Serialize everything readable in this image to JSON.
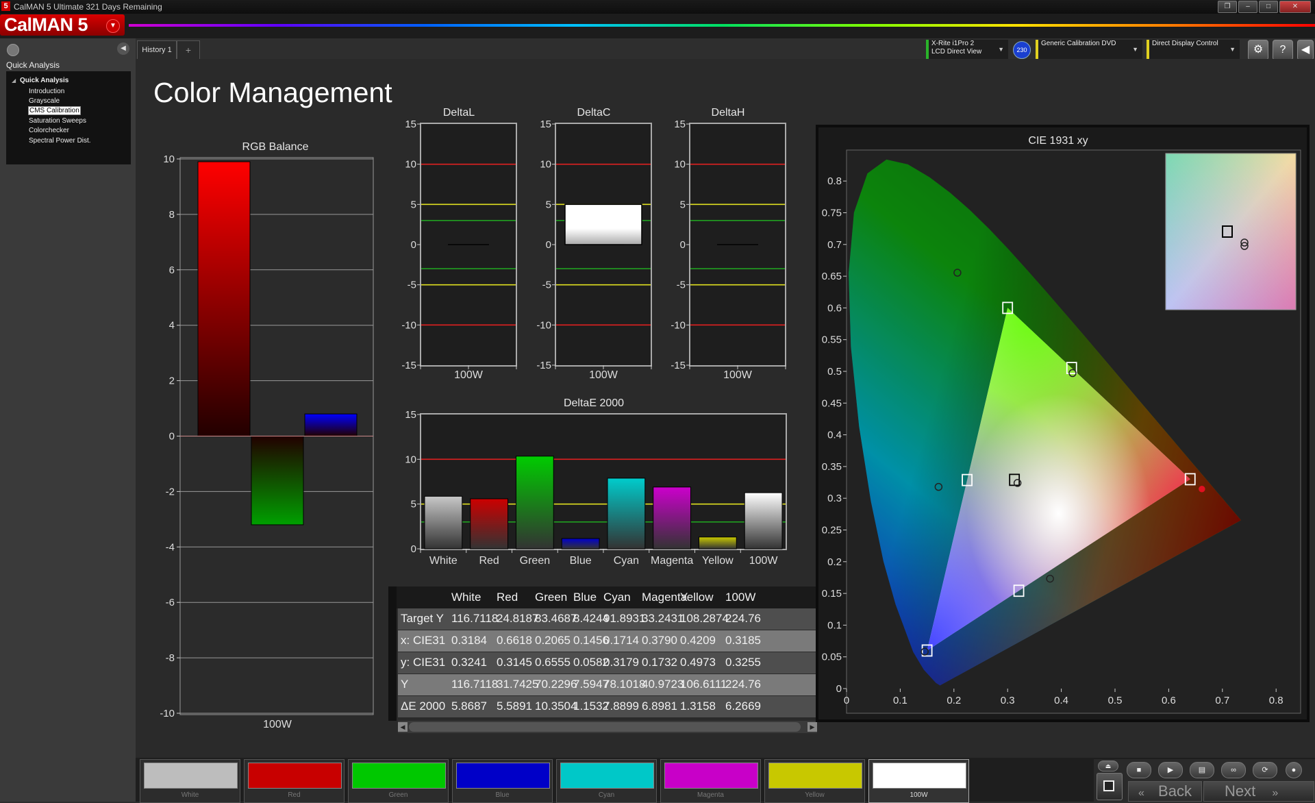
{
  "window": {
    "title": "CalMAN 5 Ultimate 321 Days Remaining",
    "logo_mark": "5",
    "controls": [
      "restore-icon",
      "minimize-icon",
      "maximize-icon",
      "close-icon"
    ]
  },
  "brand": {
    "name": "CalMAN 5"
  },
  "sidebar": {
    "heading": "Quick Analysis",
    "tree_root": "Quick Analysis",
    "items": [
      {
        "label": "Introduction",
        "selected": false
      },
      {
        "label": "Grayscale",
        "selected": false
      },
      {
        "label": "CMS Calibration",
        "selected": true
      },
      {
        "label": "Saturation Sweeps",
        "selected": false
      },
      {
        "label": "Colorchecker",
        "selected": false
      },
      {
        "label": "Spectral Power Dist.",
        "selected": false
      }
    ]
  },
  "tabs": {
    "history": "History 1",
    "add": "+"
  },
  "devices": {
    "meter_line1": "X-Rite i1Pro 2",
    "meter_line2": "LCD Direct View",
    "badge": "230",
    "source": "Generic Calibration DVD",
    "display": "Direct Display Control"
  },
  "page": {
    "title": "Color Management"
  },
  "rgb_balance": {
    "title": "RGB Balance",
    "category": "100W",
    "yticks": [
      "10",
      "8",
      "6",
      "4",
      "2",
      "0",
      "-2",
      "-4",
      "-6",
      "-8",
      "-10"
    ]
  },
  "delta_charts": {
    "deltal": {
      "title": "DeltaL",
      "category": "100W"
    },
    "deltac": {
      "title": "DeltaC",
      "category": "100W"
    },
    "deltah": {
      "title": "DeltaH",
      "category": "100W"
    },
    "yticks": [
      "15",
      "10",
      "5",
      "0",
      "-5",
      "-10",
      "-15"
    ]
  },
  "deltae": {
    "title": "DeltaE 2000",
    "yticks": [
      "15",
      "10",
      "5",
      "0"
    ]
  },
  "cie": {
    "title": "CIE 1931 xy",
    "xticks": [
      "0",
      "0.1",
      "0.2",
      "0.3",
      "0.4",
      "0.5",
      "0.6",
      "0.7",
      "0.8"
    ],
    "yticks": [
      "0",
      "0.05",
      "0.1",
      "0.15",
      "0.2",
      "0.25",
      "0.3",
      "0.35",
      "0.4",
      "0.45",
      "0.5",
      "0.55",
      "0.6",
      "0.65",
      "0.7",
      "0.75",
      "0.8"
    ]
  },
  "table": {
    "headers": [
      "",
      "White",
      "Red",
      "Green",
      "Blue",
      "Cyan",
      "Magenta",
      "Yellow",
      "100W"
    ],
    "rows": [
      [
        "Target Y",
        "116.7118",
        "24.8187",
        "83.4687",
        "8.4244",
        "91.8931",
        "33.2431",
        "108.2874",
        "224.76"
      ],
      [
        "x: CIE31",
        "0.3184",
        "0.6618",
        "0.2065",
        "0.1456",
        "0.1714",
        "0.3790",
        "0.4209",
        "0.3185"
      ],
      [
        "y: CIE31",
        "0.3241",
        "0.3145",
        "0.6555",
        "0.0582",
        "0.3179",
        "0.1732",
        "0.4973",
        "0.3255"
      ],
      [
        "Y",
        "116.7118",
        "31.7425",
        "70.2296",
        "7.5947",
        "78.1018",
        "40.9723",
        "106.6111",
        "224.76"
      ],
      [
        "ΔE 2000",
        "5.8687",
        "5.5891",
        "10.3504",
        "1.1532",
        "7.8899",
        "6.8981",
        "1.3158",
        "6.2669"
      ]
    ]
  },
  "swatches": [
    {
      "label": "White",
      "color": "#bdbdbd"
    },
    {
      "label": "Red",
      "color": "#c80000"
    },
    {
      "label": "Green",
      "color": "#00c800"
    },
    {
      "label": "Blue",
      "color": "#0000c8"
    },
    {
      "label": "Cyan",
      "color": "#00c8c8"
    },
    {
      "label": "Magenta",
      "color": "#c800c8"
    },
    {
      "label": "Yellow",
      "color": "#c8c800"
    },
    {
      "label": "100W",
      "color": "#ffffff"
    }
  ],
  "nav": {
    "back": "Back",
    "next": "Next"
  },
  "chart_data": [
    {
      "type": "bar",
      "title": "RGB Balance",
      "categories": [
        "100W"
      ],
      "series": [
        {
          "values": [
            9.9
          ],
          "color": "#ff0000"
        },
        {
          "values": [
            -3.2
          ],
          "color": "#00a000"
        },
        {
          "values": [
            0.8
          ],
          "color": "#0000ff"
        }
      ],
      "ylim": [
        -10,
        10
      ],
      "grid": true
    },
    {
      "type": "bar",
      "title": "DeltaL",
      "categories": [
        "100W"
      ],
      "values": [
        0
      ],
      "ylim": [
        -15,
        15
      ],
      "reference_lines": [
        {
          "value": 10,
          "color": "#e02020"
        },
        {
          "value": 5,
          "color": "#e0e020"
        },
        {
          "value": 3,
          "color": "#20a020"
        },
        {
          "value": -3,
          "color": "#20a020"
        },
        {
          "value": -5,
          "color": "#e0e020"
        },
        {
          "value": -10,
          "color": "#e02020"
        }
      ]
    },
    {
      "type": "bar",
      "title": "DeltaC",
      "categories": [
        "100W"
      ],
      "values": [
        5.0
      ],
      "ylim": [
        -15,
        15
      ],
      "reference_lines": [
        {
          "value": 10,
          "color": "#e02020"
        },
        {
          "value": 5,
          "color": "#e0e020"
        },
        {
          "value": 3,
          "color": "#20a020"
        },
        {
          "value": -3,
          "color": "#20a020"
        },
        {
          "value": -5,
          "color": "#e0e020"
        },
        {
          "value": -10,
          "color": "#e02020"
        }
      ]
    },
    {
      "type": "bar",
      "title": "DeltaH",
      "categories": [
        "100W"
      ],
      "values": [
        0
      ],
      "ylim": [
        -15,
        15
      ],
      "reference_lines": [
        {
          "value": 10,
          "color": "#e02020"
        },
        {
          "value": 5,
          "color": "#e0e020"
        },
        {
          "value": 3,
          "color": "#20a020"
        },
        {
          "value": -3,
          "color": "#20a020"
        },
        {
          "value": -5,
          "color": "#e0e020"
        },
        {
          "value": -10,
          "color": "#e02020"
        }
      ]
    },
    {
      "type": "bar",
      "title": "DeltaE 2000",
      "categories": [
        "White",
        "Red",
        "Green",
        "Blue",
        "Cyan",
        "Magenta",
        "Yellow",
        "100W"
      ],
      "values": [
        5.8687,
        5.5891,
        10.3504,
        1.1532,
        7.8899,
        6.8981,
        1.3158,
        6.2669
      ],
      "colors": [
        "#c8c8c8",
        "#cc0000",
        "#00cc00",
        "#0000cc",
        "#00cccc",
        "#cc00cc",
        "#cccc00",
        "#ffffff"
      ],
      "ylim": [
        0,
        15
      ],
      "reference_lines": [
        {
          "value": 10,
          "color": "#e02020"
        },
        {
          "value": 5,
          "color": "#e0e020"
        },
        {
          "value": 3,
          "color": "#20a020"
        }
      ]
    },
    {
      "type": "scatter",
      "title": "CIE 1931 xy",
      "xlim": [
        0,
        0.8
      ],
      "ylim": [
        0,
        0.8
      ],
      "targets": [
        {
          "name": "White",
          "x": 0.3127,
          "y": 0.329
        },
        {
          "name": "Red",
          "x": 0.64,
          "y": 0.33
        },
        {
          "name": "Green",
          "x": 0.3,
          "y": 0.6
        },
        {
          "name": "Blue",
          "x": 0.15,
          "y": 0.06
        },
        {
          "name": "Cyan",
          "x": 0.2246,
          "y": 0.3287
        },
        {
          "name": "Magenta",
          "x": 0.3209,
          "y": 0.1542
        },
        {
          "name": "Yellow",
          "x": 0.4193,
          "y": 0.5053
        }
      ],
      "measured": [
        {
          "name": "White",
          "x": 0.3184,
          "y": 0.3241
        },
        {
          "name": "Red",
          "x": 0.6618,
          "y": 0.3145
        },
        {
          "name": "Green",
          "x": 0.2065,
          "y": 0.6555
        },
        {
          "name": "Blue",
          "x": 0.1456,
          "y": 0.0582
        },
        {
          "name": "Cyan",
          "x": 0.1714,
          "y": 0.3179
        },
        {
          "name": "Magenta",
          "x": 0.379,
          "y": 0.1732
        },
        {
          "name": "Yellow",
          "x": 0.4209,
          "y": 0.4973
        }
      ]
    }
  ]
}
